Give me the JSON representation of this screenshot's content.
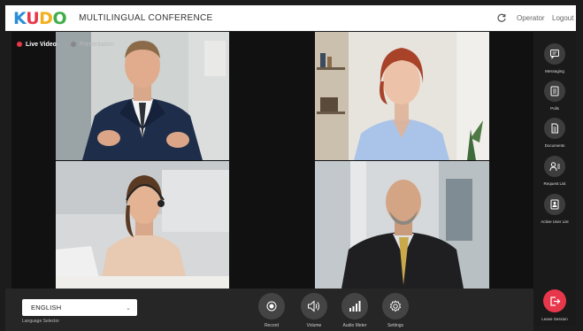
{
  "header": {
    "logo_letters": [
      "K",
      "U",
      "D",
      "O"
    ],
    "logo_colors": [
      "#2a8fd6",
      "#e8374b",
      "#f2b01e",
      "#3fae49"
    ],
    "title": "MULTILINGUAL CONFERENCE",
    "refresh_icon": "refresh-icon",
    "operator_label": "Operator",
    "logout_label": "Logout"
  },
  "stream_tabs": {
    "live_label": "Live Video",
    "separator": "|",
    "presentation_label": "Presentation"
  },
  "sidebar": {
    "items": [
      {
        "label": "Messaging",
        "icon": "message-icon"
      },
      {
        "label": "Polls",
        "icon": "polls-icon"
      },
      {
        "label": "Documents",
        "icon": "document-icon"
      },
      {
        "label": "Request List",
        "icon": "request-list-icon"
      },
      {
        "label": "Active User List",
        "icon": "active-user-icon"
      }
    ],
    "leave_label": "Leave Session",
    "leave_color": "#e8374b"
  },
  "bottom": {
    "language_value": "ENGLISH",
    "language_label": "Language Selector",
    "controls": [
      {
        "label": "Record",
        "icon": "record-icon"
      },
      {
        "label": "Volume",
        "icon": "volume-icon"
      },
      {
        "label": "Audio Meter",
        "icon": "audio-meter-icon"
      },
      {
        "label": "Settings",
        "icon": "settings-icon"
      }
    ]
  }
}
